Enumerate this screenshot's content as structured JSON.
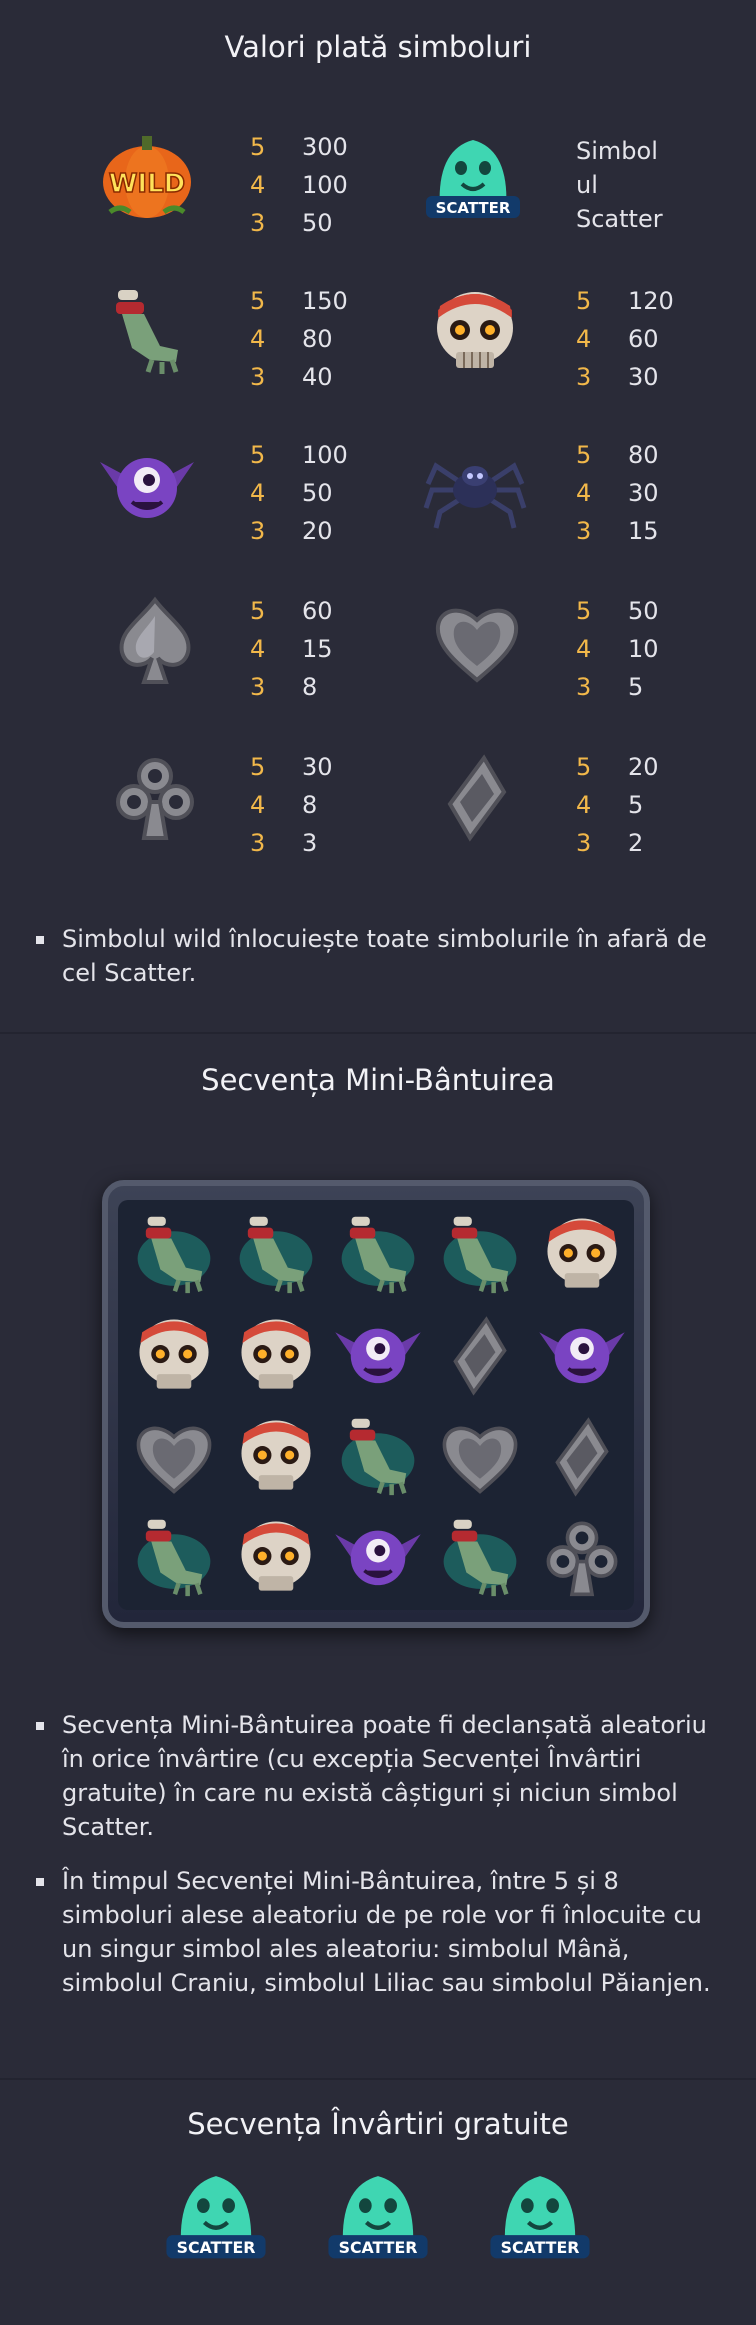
{
  "paytable": {
    "title": "Valori plată simboluri",
    "symbols": [
      {
        "name": "wild-pumpkin",
        "pays": [
          {
            "n": "5",
            "v": "300"
          },
          {
            "n": "4",
            "v": "100"
          },
          {
            "n": "3",
            "v": "50"
          }
        ]
      },
      {
        "name": "scatter-ghost",
        "text_lines": [
          "Simbol",
          "ul",
          "Scatter"
        ]
      },
      {
        "name": "zombie-hand",
        "pays": [
          {
            "n": "5",
            "v": "150"
          },
          {
            "n": "4",
            "v": "80"
          },
          {
            "n": "3",
            "v": "40"
          }
        ]
      },
      {
        "name": "skull",
        "pays": [
          {
            "n": "5",
            "v": "120"
          },
          {
            "n": "4",
            "v": "60"
          },
          {
            "n": "3",
            "v": "30"
          }
        ]
      },
      {
        "name": "bat",
        "pays": [
          {
            "n": "5",
            "v": "100"
          },
          {
            "n": "4",
            "v": "50"
          },
          {
            "n": "3",
            "v": "20"
          }
        ]
      },
      {
        "name": "spider",
        "pays": [
          {
            "n": "5",
            "v": "80"
          },
          {
            "n": "4",
            "v": "30"
          },
          {
            "n": "3",
            "v": "15"
          }
        ]
      },
      {
        "name": "spade",
        "pays": [
          {
            "n": "5",
            "v": "60"
          },
          {
            "n": "4",
            "v": "15"
          },
          {
            "n": "3",
            "v": "8"
          }
        ]
      },
      {
        "name": "heart",
        "pays": [
          {
            "n": "5",
            "v": "50"
          },
          {
            "n": "4",
            "v": "10"
          },
          {
            "n": "3",
            "v": "5"
          }
        ]
      },
      {
        "name": "club",
        "pays": [
          {
            "n": "5",
            "v": "30"
          },
          {
            "n": "4",
            "v": "8"
          },
          {
            "n": "3",
            "v": "3"
          }
        ]
      },
      {
        "name": "diamond",
        "pays": [
          {
            "n": "5",
            "v": "20"
          },
          {
            "n": "4",
            "v": "5"
          },
          {
            "n": "3",
            "v": "2"
          }
        ]
      }
    ],
    "wild_note": "Simbolul wild înlocuiește toate simbolurile în afară de cel Scatter."
  },
  "mini_haunt": {
    "title": "Secvența Mini-Bântuirea",
    "grid": [
      [
        "hand",
        "hand",
        "hand",
        "hand",
        "skull"
      ],
      [
        "skull",
        "skull",
        "bat",
        "diamond",
        "bat"
      ],
      [
        "heart",
        "skull",
        "hand",
        "heart",
        "diamond"
      ],
      [
        "hand",
        "skull",
        "bat",
        "hand",
        "club"
      ]
    ],
    "bullets": [
      "Secvența Mini-Bântuirea poate fi declanșată aleatoriu în orice învârtire (cu excepția Secvenței Învârtiri gratuite) în care nu există câștiguri și niciun simbol Scatter.",
      "În timpul Secvenței Mini-Bântuirea, între 5 și 8 simboluri alese aleatoriu de pe role vor fi înlocuite cu un singur simbol ales aleatoriu: simbolul Mână, simbolul Craniu, simbolul Liliac sau simbolul Păianjen."
    ]
  },
  "free_spins": {
    "title": "Secvența Învârtiri gratuite",
    "scatter_label": "SCATTER",
    "wild_label": "WILD"
  },
  "colors": {
    "background": "#2a2b38",
    "multiplier": "#f2b84a",
    "text": "#e4e4ea"
  }
}
